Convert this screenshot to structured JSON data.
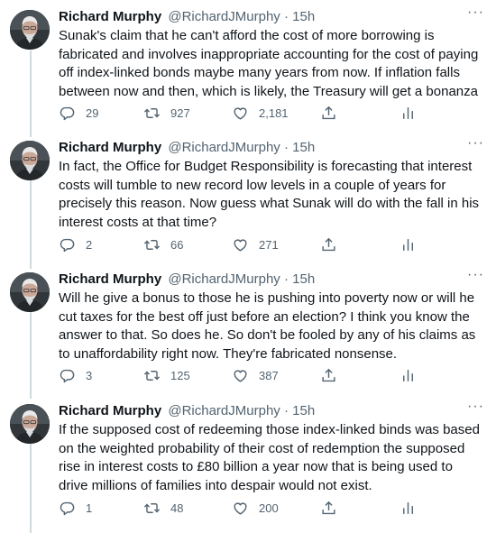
{
  "tweets": [
    {
      "name": "Richard Murphy",
      "handle": "@RichardJMurphy",
      "time": "15h",
      "text": "Sunak's claim that he can't afford the cost of more borrowing is fabricated and involves inappropriate accounting for the cost of paying off index-linked bonds maybe many years from now. If inflation falls between now and then, which is likely, the Treasury will get a bonanza",
      "replies": "29",
      "retweets": "927",
      "likes": "2,181"
    },
    {
      "name": "Richard Murphy",
      "handle": "@RichardJMurphy",
      "time": "15h",
      "text": "In fact, the Office for Budget Responsibility is forecasting that interest costs will tumble to new record low levels in a couple of years for precisely this reason. Now guess what Sunak will do with the fall in his interest costs at that time?",
      "replies": "2",
      "retweets": "66",
      "likes": "271"
    },
    {
      "name": "Richard Murphy",
      "handle": "@RichardJMurphy",
      "time": "15h",
      "text": "Will he give a bonus to those he is pushing into poverty now or will he cut taxes for the best off just before an election? I think you know the answer to that. So does he. So don't be fooled by any of his claims as to unaffordability right now. They're fabricated nonsense.",
      "replies": "3",
      "retweets": "125",
      "likes": "387"
    },
    {
      "name": "Richard Murphy",
      "handle": "@RichardJMurphy",
      "time": "15h",
      "text": "If the supposed cost of redeeming those index-linked binds was based on the weighted probability of their cost of redemption the supposed rise in interest costs to £80 billion a year now that is being used to drive millions of families into despair would not exist.",
      "replies": "1",
      "retweets": "48",
      "likes": "200"
    }
  ],
  "separator": "·",
  "more_glyph": "···",
  "colors": {
    "text": "#0f1419",
    "secondary": "#536471",
    "thread_line": "#cfd9de"
  },
  "icons": [
    "reply-icon",
    "retweet-icon",
    "like-icon",
    "share-icon",
    "analytics-icon",
    "more-icon",
    "avatar"
  ]
}
